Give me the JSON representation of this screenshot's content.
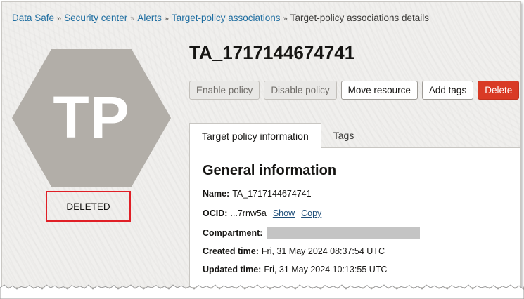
{
  "breadcrumb": {
    "items": [
      "Data Safe",
      "Security center",
      "Alerts",
      "Target-policy associations"
    ],
    "current": "Target-policy associations details",
    "separator": "»"
  },
  "resource": {
    "initials": "TP",
    "name": "TA_1717144674741",
    "status": "DELETED",
    "icon_color": "#b2aea8"
  },
  "actions": {
    "enable_policy": "Enable policy",
    "disable_policy": "Disable policy",
    "move_resource": "Move resource",
    "add_tags": "Add tags",
    "delete": "Delete"
  },
  "tabs": [
    "Target policy information",
    "Tags"
  ],
  "general": {
    "title": "General information",
    "name_label": "Name:",
    "name_value": "TA_1717144674741",
    "ocid_label": "OCID:",
    "ocid_value": "...7rnw5a",
    "show_link": "Show",
    "copy_link": "Copy",
    "compartment_label": "Compartment:",
    "created_label": "Created time:",
    "created_value": "Fri, 31 May 2024 08:37:54 UTC",
    "updated_label": "Updated time:",
    "updated_value": "Fri, 31 May 2024 10:13:55 UTC"
  },
  "colors": {
    "link": "#1f6ea1",
    "danger": "#d93a25",
    "highlight_box": "#e01f26"
  }
}
